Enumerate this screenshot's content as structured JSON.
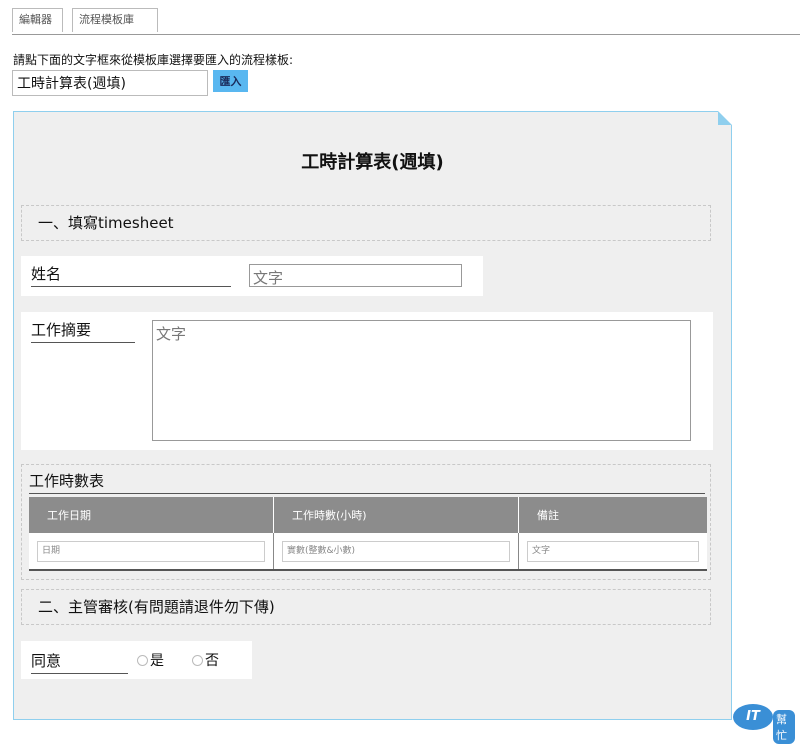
{
  "tabs": [
    {
      "label": "編輯器"
    },
    {
      "label": "流程模板庫"
    }
  ],
  "prompt": "請點下面的文字框來從模板庫選擇要匯入的流程樣板:",
  "template_input_value": "工時計算表(週填)",
  "import_button": "匯入",
  "form": {
    "title": "工時計算表(週填)",
    "section1": "一、填寫timesheet",
    "name_label": "姓名",
    "name_placeholder": "文字",
    "summary_label": "工作摘要",
    "summary_placeholder": "文字",
    "hours_title": "工作時數表",
    "table": {
      "headers": [
        "工作日期",
        "工作時數(小時)",
        "備註"
      ],
      "row_placeholders": [
        "日期",
        "實數(整數&小數)",
        "文字"
      ]
    },
    "section2": "二、主管審核(有問題請退件勿下傳)",
    "approve_label": "同意",
    "approve_options": [
      "是",
      "否"
    ]
  },
  "logo": {
    "mark": "IT",
    "caption": "幫忙"
  },
  "colors": {
    "import_button": "#59b7f0",
    "canvas_border": "#8fcfee",
    "canvas_bg": "#efefef",
    "table_header": "#8c8c8c"
  }
}
